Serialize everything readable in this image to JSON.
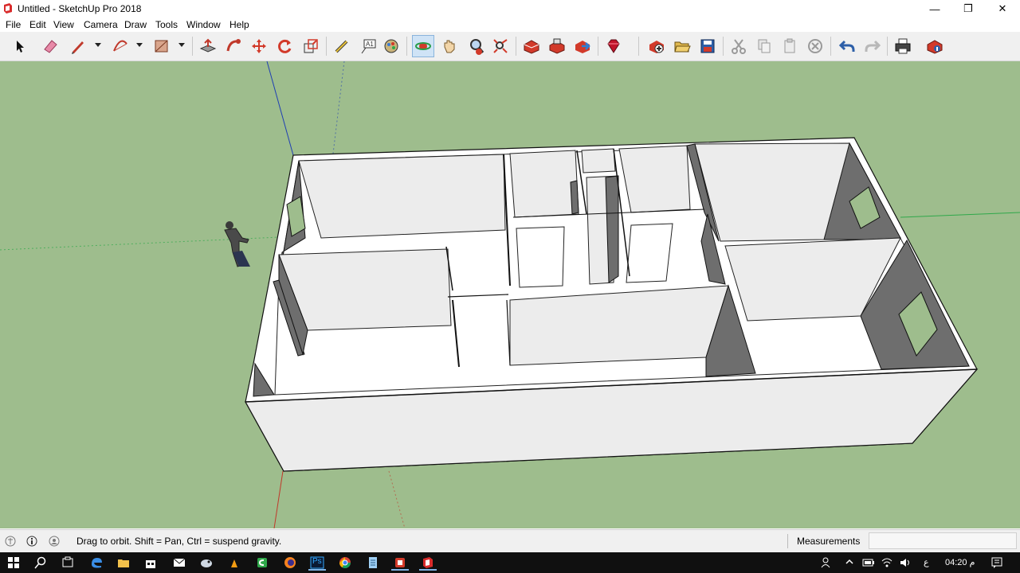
{
  "window": {
    "title": "Untitled - SketchUp Pro 2018",
    "minimize_glyph": "—",
    "restore_glyph": "❐",
    "close_glyph": "✕"
  },
  "menu": {
    "items": [
      {
        "label": "File"
      },
      {
        "label": "Edit"
      },
      {
        "label": "View"
      },
      {
        "label": "Camera"
      },
      {
        "label": "Draw"
      },
      {
        "label": "Tools"
      },
      {
        "label": "Window"
      },
      {
        "label": "Help"
      }
    ]
  },
  "toolbar": {
    "tools": [
      {
        "icon": "select-arrow-icon"
      },
      {
        "icon": "eraser-icon"
      },
      {
        "icon": "pencil-line-icon"
      },
      {
        "icon": "arc-icon"
      },
      {
        "icon": "rectangle-icon"
      },
      {
        "icon": "push-pull-icon"
      },
      {
        "icon": "follow-me-icon"
      },
      {
        "icon": "move-icon"
      },
      {
        "icon": "rotate-icon"
      },
      {
        "icon": "scale-icon"
      },
      {
        "icon": "tape-measure-icon"
      },
      {
        "icon": "text-icon"
      },
      {
        "icon": "paint-bucket-icon"
      },
      {
        "icon": "orbit-icon",
        "active": true
      },
      {
        "icon": "pan-hand-icon"
      },
      {
        "icon": "zoom-icon"
      },
      {
        "icon": "zoom-extents-icon"
      },
      {
        "icon": "warehouse-icon"
      },
      {
        "icon": "share-model-icon"
      },
      {
        "icon": "extension-warehouse-icon"
      },
      {
        "icon": "ruby-gem-icon"
      },
      {
        "icon": "new-file-icon"
      },
      {
        "icon": "open-folder-icon"
      },
      {
        "icon": "save-disk-icon"
      },
      {
        "icon": "cut-icon"
      },
      {
        "icon": "copy-icon"
      },
      {
        "icon": "paste-icon"
      },
      {
        "icon": "delete-icon"
      },
      {
        "icon": "undo-icon"
      },
      {
        "icon": "redo-icon"
      },
      {
        "icon": "print-icon"
      },
      {
        "icon": "model-info-icon"
      }
    ]
  },
  "status": {
    "message": "Drag to orbit.  Shift = Pan, Ctrl = suspend gravity.",
    "measurements_label": "Measurements",
    "measurements_value": ""
  },
  "taskbar": {
    "apps": [
      {
        "icon": "windows-start-icon"
      },
      {
        "icon": "search-icon"
      },
      {
        "icon": "task-view-icon"
      },
      {
        "icon": "edge-browser-icon"
      },
      {
        "icon": "file-explorer-icon"
      },
      {
        "icon": "mail-icon"
      },
      {
        "icon": "store-icon"
      },
      {
        "icon": "app-orange-icon"
      },
      {
        "icon": "app-green-icon"
      },
      {
        "icon": "firefox-icon"
      },
      {
        "icon": "photoshop-icon",
        "label": "Ps"
      },
      {
        "icon": "chrome-icon"
      },
      {
        "icon": "notepad-icon"
      },
      {
        "icon": "app-red-icon"
      },
      {
        "icon": "sketchup-icon"
      }
    ],
    "tray": {
      "lang": "ع",
      "time": "04:20 م"
    }
  },
  "colors": {
    "ground": "#9ebd8d",
    "wall_top": "#ffffff",
    "wall_face": "#ececec",
    "wall_shadow": "#6e6e6e",
    "axis_blue": "#1f3fb3",
    "axis_green": "#2fa84a",
    "axis_red": "#c0392b",
    "active_tool": "#cfe3f6"
  }
}
